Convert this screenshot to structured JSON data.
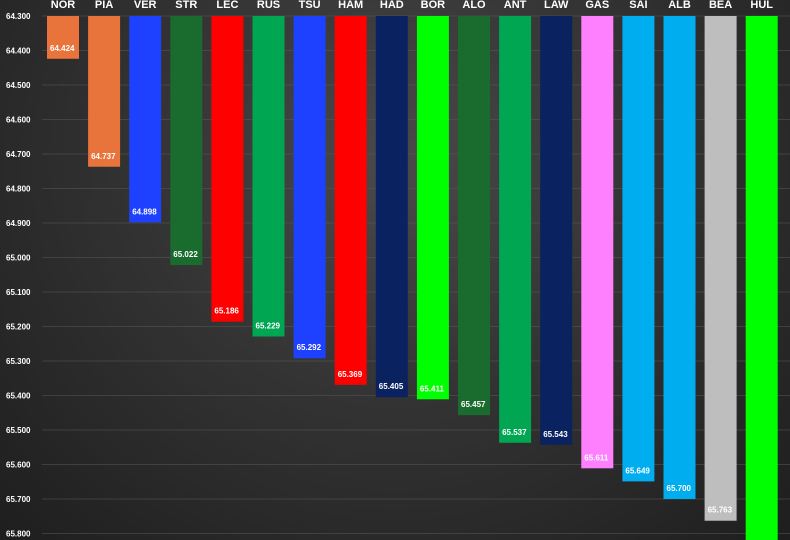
{
  "chart_data": {
    "type": "bar",
    "orientation": "vertical-downward",
    "categories": [
      "NOR",
      "PIA",
      "VER",
      "STR",
      "LEC",
      "RUS",
      "TSU",
      "HAM",
      "HAD",
      "BOR",
      "ALO",
      "ANT",
      "LAW",
      "GAS",
      "SAI",
      "ALB",
      "BEA",
      "HUL"
    ],
    "values": [
      64.424,
      64.737,
      64.898,
      65.022,
      65.186,
      65.229,
      65.292,
      65.369,
      65.405,
      65.411,
      65.457,
      65.537,
      65.543,
      65.611,
      65.649,
      65.7,
      65.763,
      null
    ],
    "value_labels": [
      "64.424",
      "64.737",
      "64.898",
      "65.022",
      "65.186",
      "65.229",
      "65.292",
      "65.369",
      "65.405",
      "65.411",
      "65.457",
      "65.537",
      "65.543",
      "65.611",
      "65.649",
      "65.700",
      "65.763",
      ""
    ],
    "colors": [
      "#E8743B",
      "#E8743B",
      "#1E41FF",
      "#1A6B2E",
      "#FF0000",
      "#00A651",
      "#1E41FF",
      "#FF0000",
      "#0B2260",
      "#00FF00",
      "#1A6B2E",
      "#00A651",
      "#0B2260",
      "#FF80FF",
      "#00AEEF",
      "#00AEEF",
      "#BEBEBE",
      "#00FF00"
    ],
    "y_ticks": [
      "64.300",
      "64.400",
      "64.500",
      "64.600",
      "64.700",
      "64.800",
      "64.900",
      "65.000",
      "65.100",
      "65.200",
      "65.300",
      "65.400",
      "65.500",
      "65.600",
      "65.700",
      "65.800"
    ],
    "ylim": [
      64.3,
      65.8
    ],
    "grid": true,
    "title": "",
    "xlabel": "",
    "ylabel": ""
  }
}
